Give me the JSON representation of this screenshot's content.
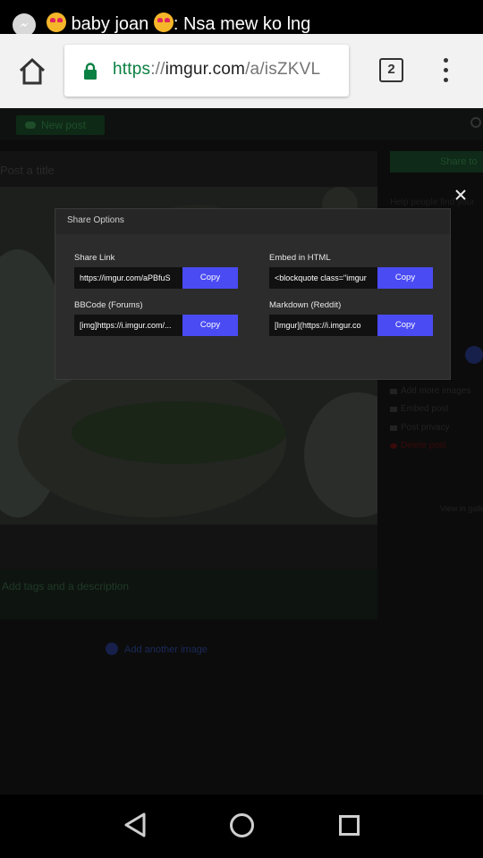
{
  "notification": {
    "text_prefix": "baby joan",
    "text_suffix": ": Nsa mew ko lng",
    "app_icon": "messenger-icon"
  },
  "browser": {
    "url_scheme": "https",
    "url_sep": "://",
    "url_host": "imgur.com",
    "url_path": "/a/isZKVL",
    "tab_count": "2",
    "icons": [
      "home-icon",
      "lock-icon",
      "tab-switcher-icon",
      "overflow-menu-icon"
    ],
    "accent_color": "#0b8043"
  },
  "modal": {
    "title": "Share Options",
    "close_icon": "close-icon",
    "fields": [
      {
        "label": "Share Link",
        "value": "https://imgur.com/aPBfuS",
        "button": "Copy"
      },
      {
        "label": "Embed in HTML",
        "value": "<blockquote class=\"imgur",
        "button": "Copy"
      },
      {
        "label": "BBCode (Forums)",
        "value": "[img]https://i.imgur.com/...",
        "button": "Copy"
      },
      {
        "label": "Markdown (Reddit)",
        "value": "[Imgur](https://i.imgur.co",
        "button": "Copy"
      }
    ],
    "button_color": "#4a4bf3"
  },
  "background_page": {
    "new_post": "New post",
    "post_title": "Post a title",
    "share_to": "Share to",
    "help_text": "Help people find your",
    "description": "Add tags and a description",
    "add_another_image": "Add another image",
    "side_links": [
      "Add more images",
      "Embed post",
      "Post privacy",
      "Delete post"
    ],
    "view_link": "View in gallery"
  },
  "system_nav": {
    "icons": [
      "back-icon",
      "home-circle-icon",
      "recents-icon"
    ]
  }
}
